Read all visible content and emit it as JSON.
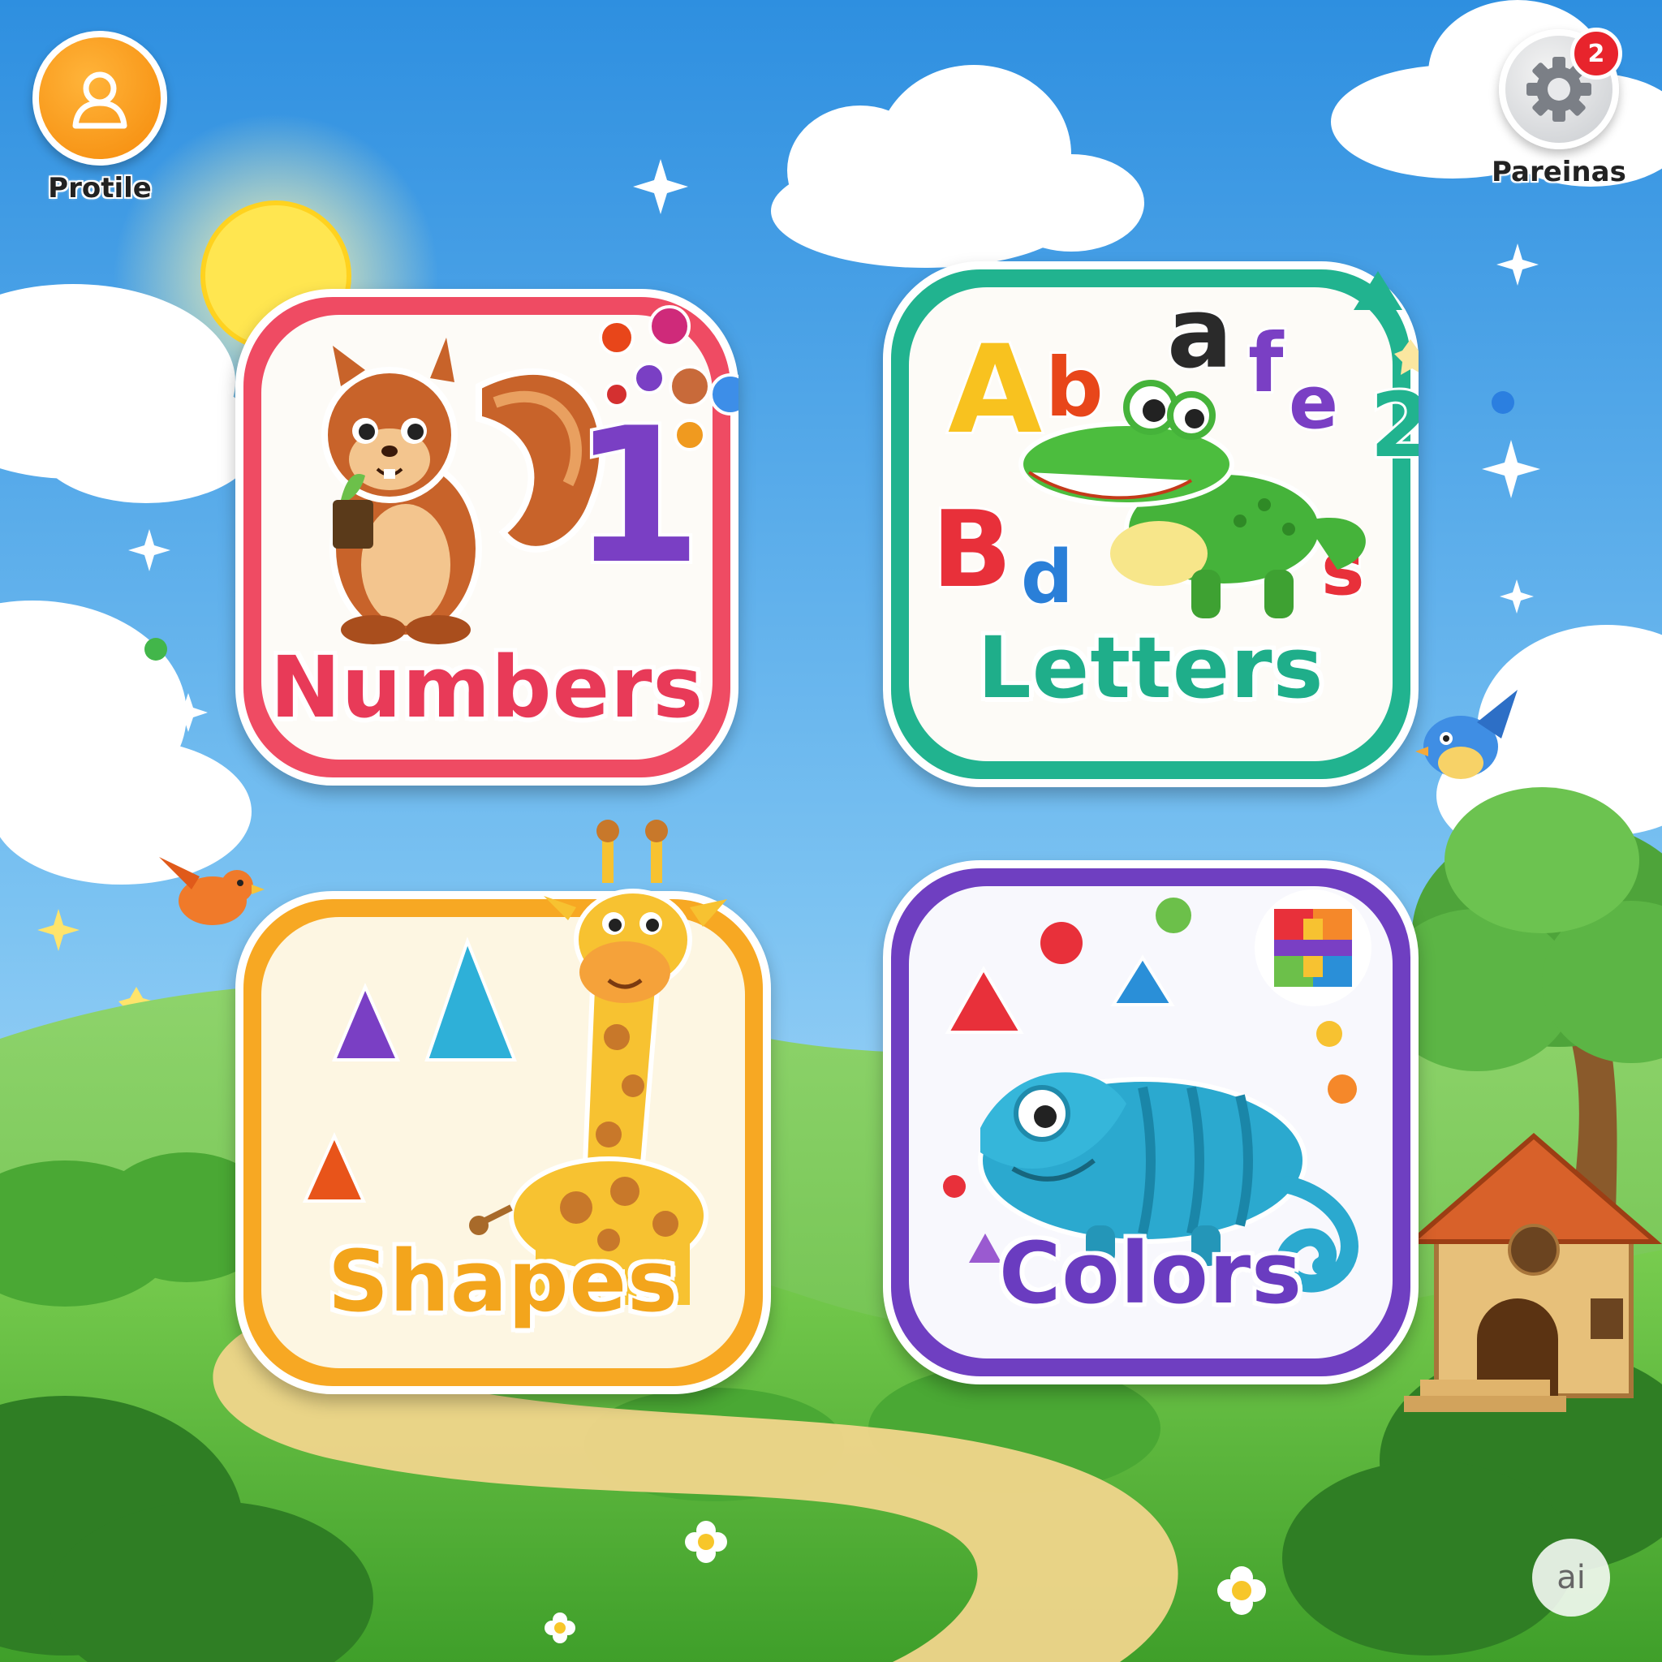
{
  "header": {
    "profile": {
      "label": "Protile",
      "icon": "user-icon",
      "color": "#f7930f"
    },
    "settings": {
      "label": "Pareinas",
      "icon": "gear-icon",
      "badge_count": "2",
      "badge_color": "#e8242c"
    }
  },
  "cards": [
    {
      "id": "numbers",
      "title": "Numbers",
      "color": "#ef4b63",
      "mascot": "squirrel",
      "numeral": "1"
    },
    {
      "id": "letters",
      "title": "Letters",
      "color": "#21b38f",
      "mascot": "alligator",
      "glyphs": [
        "A",
        "b",
        "a",
        "f",
        "e",
        "2",
        "B",
        "d",
        "s"
      ]
    },
    {
      "id": "shapes",
      "title": "Shapes",
      "color": "#f7a823",
      "mascot": "giraffe"
    },
    {
      "id": "colors",
      "title": "Colors",
      "color": "#6f3fc1",
      "mascot": "chameleon"
    }
  ],
  "watermark": {
    "text": "ai"
  }
}
